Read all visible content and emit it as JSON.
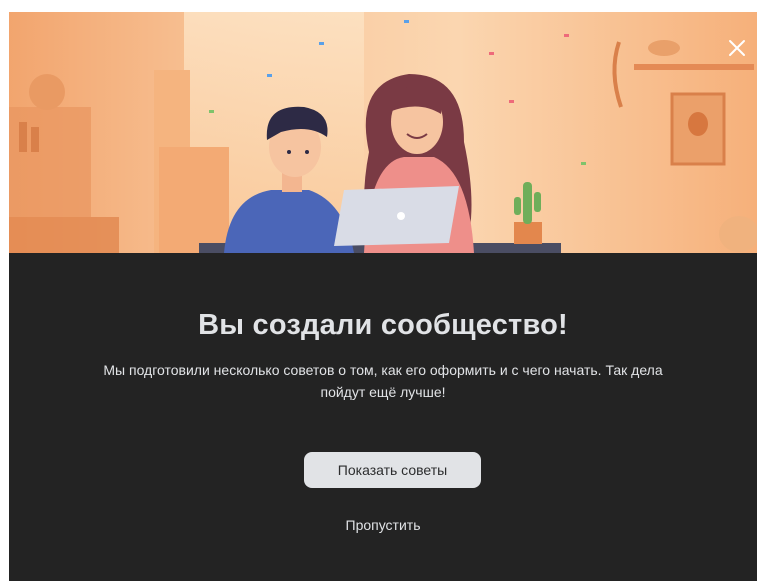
{
  "dialog": {
    "title": "Вы создали сообщество!",
    "description": "Мы подготовили несколько советов о том, как его оформить и с чего начать. Так дела пойдут ещё лучше!",
    "primary_button": "Показать советы",
    "skip_link": "Пропустить",
    "close_icon": "close-icon"
  },
  "colors": {
    "background": "#232323",
    "text": "#e1e3e6",
    "button_bg": "#e1e3e6",
    "button_text": "#2c2d2e",
    "hero_warm": "#f6b07a"
  }
}
